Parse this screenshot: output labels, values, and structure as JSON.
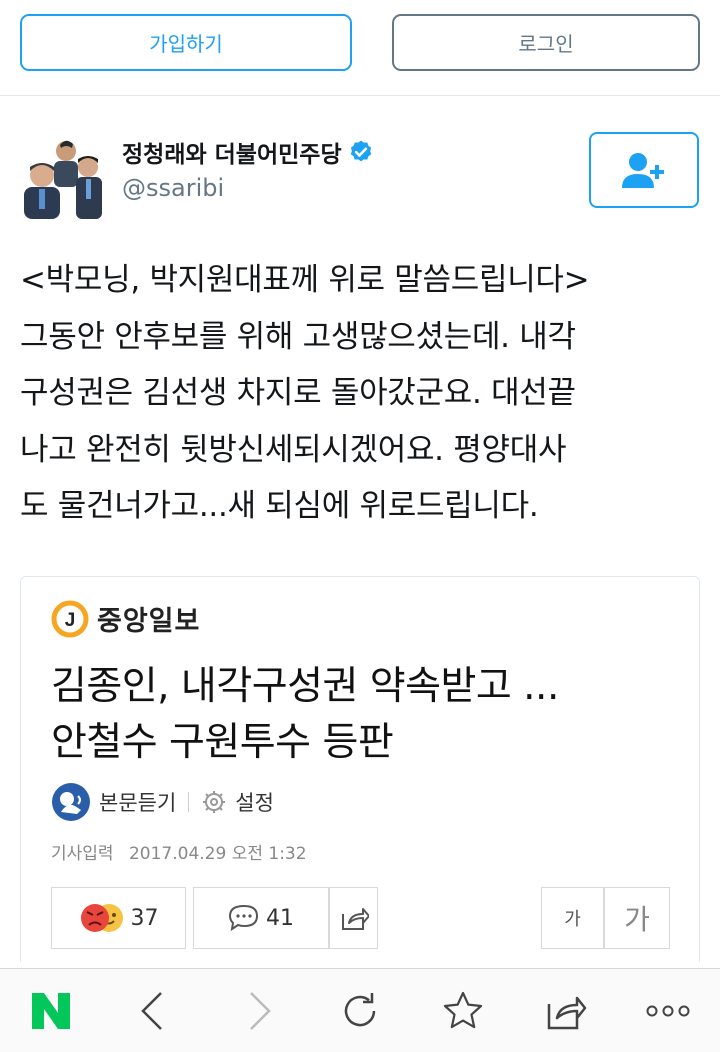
{
  "auth": {
    "signup_label": "가입하기",
    "login_label": "로그인"
  },
  "tweet": {
    "display_name": "정청래와 더불어민주당",
    "handle": "@ssaribi",
    "text_lines": [
      "<박모닝, 박지원대표께 위로 말씀드립니다>",
      "그동안 안후보를 위해 고생많으셨는데. 내각",
      "구성권은 김선생 차지로 돌아갔군요. 대선끝",
      "나고 완전히 뒷방신세되시겠어요. 평양대사",
      "도 물건너가고...새 되심에 위로드립니다."
    ]
  },
  "card": {
    "publisher_logo_letter": "J",
    "publisher_name": "중앙일보",
    "headline_lines": [
      "김종인, 내각구성권 약속받고 ...",
      "안철수 구원투수 등판"
    ],
    "listen_label": "본문듣기",
    "settings_label": "설정",
    "date_label": "기사입력",
    "date_value": "2017.04.29 오전 1:32",
    "reactions_count": "37",
    "comments_count": "41",
    "font_small_label": "가",
    "font_large_label": "가"
  },
  "icons": {
    "follow": "add-user-icon",
    "verified": "verified-badge-icon",
    "home": "naver-n-logo",
    "back": "chevron-left-icon",
    "forward": "chevron-right-icon",
    "refresh": "refresh-icon",
    "bookmark": "star-icon",
    "share": "share-icon",
    "more": "more-dots-icon"
  },
  "colors": {
    "twitter_blue": "#1da1f2",
    "naver_green": "#03c75a",
    "joongang_orange": "#f5a623"
  }
}
